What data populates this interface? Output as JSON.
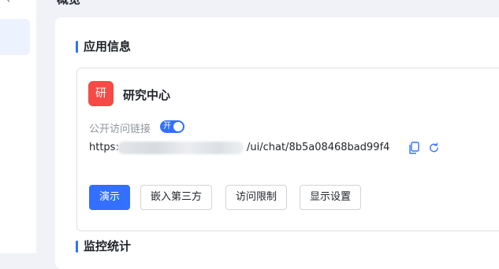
{
  "page": {
    "title": "概览"
  },
  "app_info": {
    "section_title": "应用信息",
    "avatar_char": "研",
    "name": "研究中心",
    "public_access_label": "公开访问链接",
    "toggle_label": "开",
    "link_prefix": "https:",
    "link_suffix": "/ui/chat/8b5a08468bad99f4",
    "buttons": {
      "demo": "演示",
      "embed": "嵌入第三方",
      "access_limit": "访问限制",
      "display_settings": "显示设置"
    }
  },
  "monitor": {
    "section_title": "监控统计"
  },
  "colors": {
    "accent": "#3370ff",
    "avatar_bg": "#f54a45"
  }
}
